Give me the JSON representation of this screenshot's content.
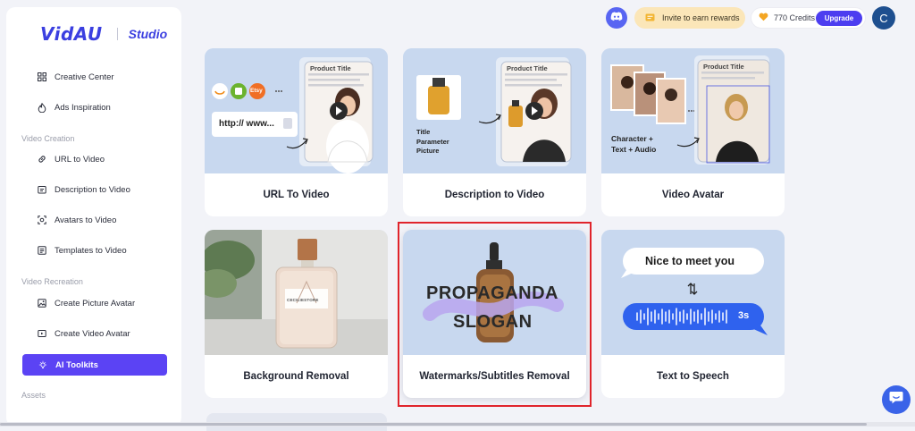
{
  "brand": {
    "name": "VidAU",
    "product": "Studio"
  },
  "sidebar": {
    "items": [
      {
        "label": "Creative Center",
        "icon": "grid-icon"
      },
      {
        "label": "Ads Inspiration",
        "icon": "fire-icon"
      }
    ],
    "groups": [
      {
        "title": "Video Creation",
        "items": [
          {
            "label": "URL to Video",
            "icon": "link-icon"
          },
          {
            "label": "Description to Video",
            "icon": "description-icon"
          },
          {
            "label": "Avatars to Video",
            "icon": "avatar-icon"
          },
          {
            "label": "Templates to Video",
            "icon": "template-icon"
          }
        ]
      },
      {
        "title": "Video Recreation",
        "items": [
          {
            "label": "Create Picture Avatar",
            "icon": "picture-icon"
          },
          {
            "label": "Create Video Avatar",
            "icon": "video-icon"
          },
          {
            "label": "AI Toolkits",
            "icon": "bulb-icon",
            "active": true
          }
        ]
      },
      {
        "title": "Assets",
        "items": []
      }
    ]
  },
  "topbar": {
    "invite_label": "Invite to earn rewards",
    "credits_label": "770 Credits",
    "upgrade_label": "Upgrade",
    "avatar_initial": "C"
  },
  "cards": [
    {
      "label": "URL To Video",
      "art": {
        "product_title": "Product Title",
        "url_text": "http:// www...",
        "marketplace": [
          "Etsy"
        ]
      }
    },
    {
      "label": "Description to Video",
      "art": {
        "product_title": "Product Title",
        "caption_lines": [
          "Title",
          "Parameter",
          "Picture"
        ]
      }
    },
    {
      "label": "Video Avatar",
      "art": {
        "product_title": "Product Title",
        "caption_lines": [
          "Character +",
          "Text + Audio"
        ]
      }
    },
    {
      "label": "Background Removal",
      "art": {
        "bottle_brand": "CECILIESTORE"
      }
    },
    {
      "label": "Watermarks/Subtitles Removal",
      "art": {
        "overlay_lines": [
          "PROPAGANDA",
          "SLOGAN"
        ]
      }
    },
    {
      "label": "Text to Speech",
      "art": {
        "bubble_text": "Nice to meet you",
        "duration": "3s"
      }
    }
  ],
  "colors": {
    "accent": "#5b43f4",
    "highlight": "#e0242b",
    "card_art_bg": "#c8d8ef"
  }
}
